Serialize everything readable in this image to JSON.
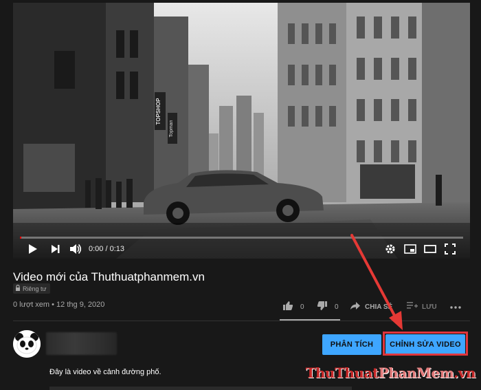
{
  "player": {
    "time_display": "0:00 / 0:13",
    "progress_fraction": 0.0
  },
  "video": {
    "title": "Video mới của Thuthuatphanmem.vn",
    "privacy_badge": "Riêng tư",
    "views_date": "0 lượt xem • 12 thg 9, 2020",
    "likes": "0",
    "dislikes": "0",
    "share_label": "CHIA SẺ",
    "save_label": "LƯU"
  },
  "channel": {
    "description": "Đây là video về cảnh đường phố."
  },
  "buttons": {
    "analytics_label": "PHÂN TÍCH",
    "edit_video_label": "CHỈNH SỬA VIDEO"
  },
  "watermark": {
    "part1": "ThuThuat",
    "part2": "PhanMem",
    "part3": ".vn"
  },
  "scene_signs": {
    "sign1": "TOPSHOP",
    "sign2": "Topman"
  },
  "colors": {
    "accent_blue": "#3ea6ff",
    "highlight_red": "#e0353c",
    "progress_red": "#ff0000"
  },
  "icons": [
    "play-icon",
    "next-icon",
    "volume-icon",
    "settings-icon",
    "miniplayer-icon",
    "theater-icon",
    "fullscreen-icon",
    "like-icon",
    "dislike-icon",
    "share-icon",
    "save-playlist-icon",
    "more-icon",
    "lock-icon"
  ]
}
